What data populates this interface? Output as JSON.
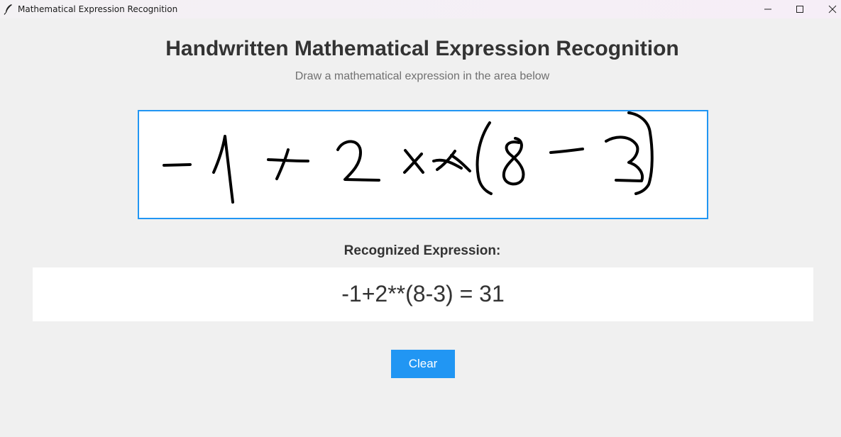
{
  "window": {
    "title": "Mathematical Expression Recognition",
    "icon": "feather-icon",
    "controls": [
      "minimize-icon",
      "maximize-icon",
      "close-icon"
    ]
  },
  "header": {
    "title": "Handwritten Mathematical Expression Recognition",
    "subtitle": "Draw a mathematical expression in the area below"
  },
  "canvas": {
    "handwritten_content": "-1+2xx(8-3)",
    "border_color": "#2196f3",
    "stroke_color": "#000000"
  },
  "result": {
    "label": "Recognized Expression:",
    "value": "-1+2**(8-3) = 31"
  },
  "actions": {
    "clear_label": "Clear",
    "accent_color": "#2196f3"
  }
}
